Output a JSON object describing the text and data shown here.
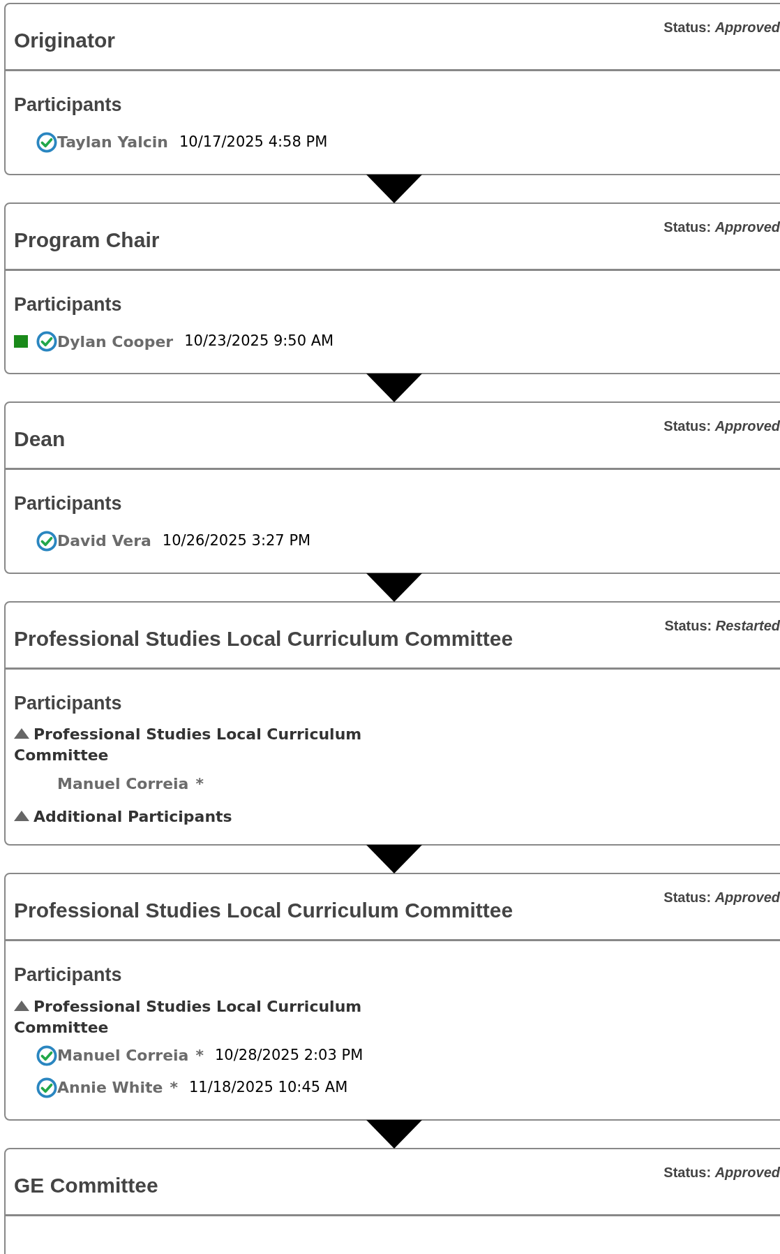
{
  "stages": [
    {
      "title": "Originator",
      "status_label": "Status:",
      "status": "Approved",
      "participants_heading": "Participants",
      "items": [
        {
          "kind": "person",
          "flagged": false,
          "approved": true,
          "name": "Taylan Yalcin",
          "date": "10/17/2025 4:58 PM"
        }
      ]
    },
    {
      "title": "Program Chair",
      "status_label": "Status:",
      "status": "Approved",
      "participants_heading": "Participants",
      "items": [
        {
          "kind": "person",
          "flagged": true,
          "approved": true,
          "name": "Dylan Cooper",
          "date": "10/23/2025 9:50 AM"
        }
      ]
    },
    {
      "title": "Dean",
      "status_label": "Status:",
      "status": "Approved",
      "participants_heading": "Participants",
      "items": [
        {
          "kind": "person",
          "flagged": false,
          "approved": true,
          "name": "David Vera",
          "date": "10/26/2025 3:27 PM"
        }
      ]
    },
    {
      "title": "Professional Studies Local Curriculum Committee",
      "status_label": "Status:",
      "status": "Restarted",
      "participants_heading": "Participants",
      "items": [
        {
          "kind": "group",
          "expanded": true,
          "label": "Professional Studies Local Curriculum Committee"
        },
        {
          "kind": "person",
          "flagged": false,
          "approved": false,
          "name": "Manuel Correia",
          "marker": "*"
        },
        {
          "kind": "group",
          "expanded": true,
          "label": "Additional Participants"
        }
      ]
    },
    {
      "title": "Professional Studies Local Curriculum Committee",
      "status_label": "Status:",
      "status": "Approved",
      "participants_heading": "Participants",
      "items": [
        {
          "kind": "group",
          "expanded": true,
          "label": "Professional Studies Local Curriculum Committee"
        },
        {
          "kind": "person",
          "flagged": false,
          "approved": true,
          "name": "Manuel Correia",
          "marker": "*",
          "date": "10/28/2025 2:03 PM"
        },
        {
          "kind": "person",
          "flagged": false,
          "approved": true,
          "name": "Annie White",
          "marker": "*",
          "date": "11/18/2025 10:45 AM"
        }
      ]
    },
    {
      "title": "GE Committee",
      "status_label": "Status:",
      "status": "Approved"
    }
  ]
}
